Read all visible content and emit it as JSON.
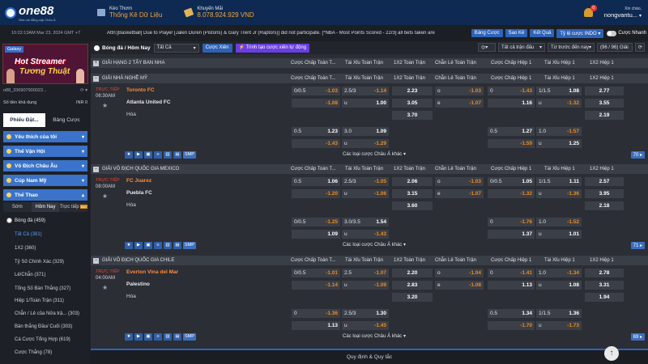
{
  "topbar": {
    "brand": "one88",
    "brand_tag": "Nhà cái đẳng cấp Châu Á",
    "kao_thom": "Kèo Thơm",
    "thong_ke": "Thống Kê Dữ Liệu",
    "khuyen_mai": "Khuyến Mãi",
    "jackpot": "8.078.924.929 VND",
    "greeting": "Xin chào,",
    "username": "nongvantu...",
    "notif_count": "0"
  },
  "infobar": {
    "datetime": "10:22:13AM Mar 23, 2024 GMT +7",
    "ticker": "Attn:[Basketball] Due to Player [Jalen Duren (Pistons) & Gary Trent Jr (Raptors)] did not participate. [*NBA - Most Points Scored - 22/3] all bets taken are",
    "btn_bang_cuoc": "Bảng Cược",
    "btn_sao_ke": "Sao Kê",
    "btn_ket_qua": "Kết Quả",
    "btn_ty_le": "Tỷ lệ cược INDO",
    "toggle_label": "Cược Nhanh"
  },
  "sidebar": {
    "banner_gal": "Galaxy",
    "banner_line1": "Hot Streamer",
    "banner_line2": "Tương Thuật",
    "account": "o88_336907900023...",
    "tien_khadung_label": "Số tiền khả dụng",
    "tien_khadung_value": "INR 0",
    "tab1": "Phiếu Đặt...",
    "tab2": "Bảng Cược",
    "cats": [
      {
        "label": "Yêu thích của tôi"
      },
      {
        "label": "Thế Vận Hội"
      },
      {
        "label": "Vô Địch Châu Âu"
      },
      {
        "label": "Cúp Nam Mỹ"
      },
      {
        "label": "Thể Thao"
      }
    ],
    "sub": {
      "s1": "Sớm",
      "s2": "Hôm Nay",
      "s3": "Trực tiếp",
      "badge": "Mới"
    },
    "sport": "Bóng đá",
    "sport_count": "(459)",
    "items": [
      "Tất Cả (381)",
      "1X2 (360)",
      "Tỷ Số Chính Xác (329)",
      "Lẻ/Chẵn (371)",
      "Tổng Số Bàn Thắng (327)",
      "Hiệp 1/Toàn Trận (311)",
      "Chẵn / Lẻ của Nửa trậ... (303)",
      "Bàn thắng Đầu/ Cuối (303)",
      "Cá Cược Tổng Hợp (619)",
      "Cược Thắng (78)"
    ]
  },
  "filter": {
    "title": "Bóng đá / Hôm Nay",
    "select1": "Tất Cả",
    "xien": "Cược Xiên",
    "tao": "Trình tạo cược xiên tự động",
    "r1": "Tất cả trận đấu",
    "r2": "Từ trước đến nay",
    "r3": "(96 / 96) Giải"
  },
  "columns": {
    "c1": "Cược Chấp Toàn T...",
    "c2": "Tài Xỉu Toàn Trận",
    "c3": "1X2 Toàn Trận",
    "c4": "Chẵn Lẻ Toàn Trận",
    "c5": "Cược Chấp Hiệp 1",
    "c6": "Tài Xỉu Hiệp 1",
    "c7": "1X2 Hiệp 1"
  },
  "collapsed_league": "GIẢI HẠNG 2 TÂY BAN NHA",
  "leagues": [
    {
      "name": "GIẢI NHÀ NGHỀ MỸ",
      "live": "TRỰC TIẾP",
      "time": "06:30AM",
      "home": "Toronto FC",
      "away": "Atlanta United FC",
      "draw": "Hòa",
      "r1": {
        "hdp_h": "0/0.5",
        "hdp_o": "-1.03",
        "ou_h": "2.5/3",
        "ou_o": "-1.14",
        "x1": "2.23",
        "oe_h": "o",
        "oe_o": "-1.03",
        "h1hdp_h": "0",
        "h1hdp_o": "-1.43",
        "h1ou_h": "1/1.5",
        "h1ou_o": "1.08",
        "h1x": "2.77"
      },
      "r2": {
        "hdp_o": "-1.08",
        "ou_h": "u",
        "ou_o": "1.00",
        "x1": "3.05",
        "oe_h": "e",
        "oe_o": "-1.07",
        "h1hdp_o": "1.16",
        "h1ou_h": "u",
        "h1ou_o": "-1.32",
        "h1x": "3.55"
      },
      "r3": {
        "x1": "3.70",
        "h1x": "2.19"
      },
      "a1": {
        "hdp_h": "0.5",
        "hdp_o": "1.23",
        "ou_h": "3.0",
        "ou_o": "1.09",
        "h1hdp_h": "0.5",
        "h1hdp_o": "1.27",
        "h1ou_h": "1.0",
        "h1ou_o": "-1.57"
      },
      "a2": {
        "hdp_o": "-1.43",
        "ou_h": "u",
        "ou_o": "-1.29",
        "h1hdp_o": "-1.59",
        "h1ou_h": "u",
        "h1ou_o": "1.25"
      },
      "more": "Các loại cược Châu Á khác",
      "page": "70"
    },
    {
      "name": "GIẢI VÔ ĐỊCH QUỐC GIA MEXICO",
      "live": "TRỰC TIẾP",
      "time": "08:00AM",
      "home": "FC Juarez",
      "away": "Puebla FC",
      "draw": "Hòa",
      "r1": {
        "hdp_h": "0.5",
        "hdp_o": "1.06",
        "ou_h": "2.5/3",
        "ou_o": "-1.05",
        "x1": "2.06",
        "oe_h": "o",
        "oe_o": "-1.03",
        "h1hdp_h": "0/0.5",
        "h1hdp_o": "1.05",
        "h1ou_h": "1/1.5",
        "h1ou_o": "1.11",
        "h1x": "2.57"
      },
      "r2": {
        "hdp_o": "-1.20",
        "ou_h": "u",
        "ou_o": "-1.06",
        "x1": "3.15",
        "oe_h": "e",
        "oe_o": "-1.07",
        "h1hdp_o": "-1.32",
        "h1ou_h": "u",
        "h1ou_o": "-1.36",
        "h1x": "3.95"
      },
      "r3": {
        "x1": "3.60",
        "h1x": "2.18"
      },
      "a1": {
        "hdp_h": "0/0.5",
        "hdp_o": "-1.25",
        "ou_h": "3.0/3.5",
        "ou_o": "1.54",
        "h1hdp_h": "0",
        "h1hdp_o": "-1.76",
        "h1ou_h": "1.0",
        "h1ou_o": "-1.52"
      },
      "a2": {
        "hdp_o": "1.09",
        "ou_h": "u",
        "ou_o": "-1.43",
        "h1hdp_o": "1.37",
        "h1ou_h": "u",
        "h1ou_o": "1.01"
      },
      "more": "Các loại cược Châu Á khác",
      "page": "71"
    },
    {
      "name": "GIẢI VÔ ĐỊCH QUỐC GIA CHILE",
      "live": "TRỰC TIẾP",
      "time": "04:00AM",
      "home": "Everton Vina del Mar",
      "away": "Palestino",
      "draw": "Hòa",
      "r1": {
        "hdp_h": "0/0.5",
        "hdp_o": "-1.01",
        "ou_h": "2.5",
        "ou_o": "-1.07",
        "x1": "2.20",
        "oe_h": "o",
        "oe_o": "-1.04",
        "h1hdp_h": "0",
        "h1hdp_o": "-1.41",
        "h1ou_h": "1.0",
        "h1ou_o": "-1.34",
        "h1x": "2.78"
      },
      "r2": {
        "hdp_o": "-1.14",
        "ou_h": "u",
        "ou_o": "-1.09",
        "x1": "2.83",
        "oe_h": "e",
        "oe_o": "-1.08",
        "h1hdp_o": "1.13",
        "h1ou_h": "u",
        "h1ou_o": "1.08",
        "h1x": "3.31"
      },
      "r3": {
        "x1": "3.20",
        "h1x": "1.94"
      },
      "a1": {
        "hdp_h": "0",
        "hdp_o": "-1.36",
        "ou_h": "2.5/3",
        "ou_o": "1.30",
        "h1hdp_h": "0.5",
        "h1hdp_o": "1.34",
        "h1ou_h": "1/1.5",
        "h1ou_o": "1.36"
      },
      "a2": {
        "hdp_o": "1.13",
        "ou_h": "u",
        "ou_o": "-1.45",
        "h1hdp_o": "-1.70",
        "h1ou_h": "u",
        "h1ou_o": "-1.73"
      },
      "more": "Các loại cược Châu Á khác",
      "page": "69"
    }
  ],
  "footer": "Quy định & Quy tắc",
  "colors": {
    "accent": "#2d63b8",
    "negative": "#ef8a1e",
    "home_team": "#ff8a3d",
    "live": "#e2453a"
  }
}
